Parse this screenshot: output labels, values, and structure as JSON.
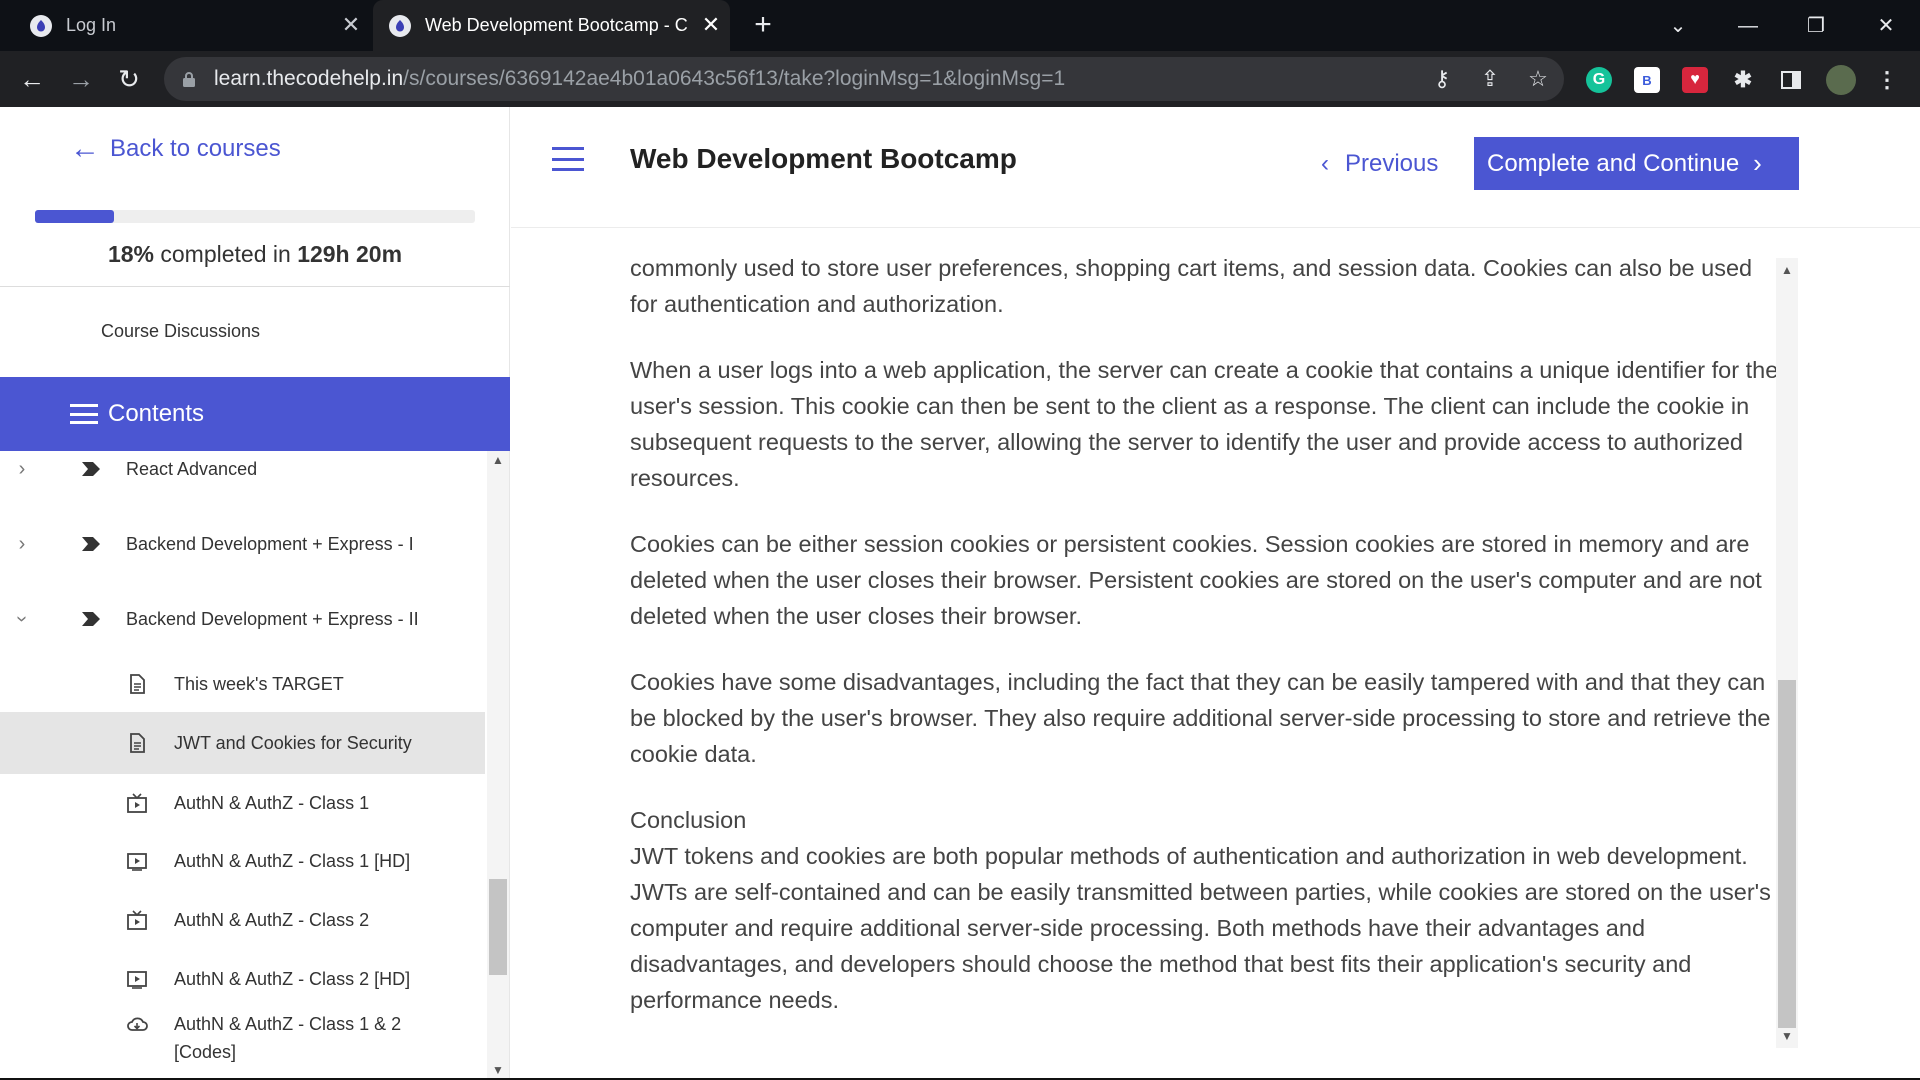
{
  "browser": {
    "tabs": [
      {
        "title": "Log In",
        "active": false
      },
      {
        "title": "Web Development Bootcamp - C",
        "active": true
      }
    ],
    "url_host": "learn.thecodehelp.in",
    "url_path": "/s/courses/6369142ae4b01a0643c56f13/take?loginMsg=1&loginMsg=1",
    "new_tab": "+",
    "close_glyph": "✕"
  },
  "sidebar": {
    "back_label": "Back to courses",
    "progress_fraction": 0.18,
    "progress_percent": "18%",
    "progress_mid": " completed in ",
    "progress_time": "129h 20m",
    "discussions_label": "Course Discussions",
    "contents_label": "Contents",
    "sections": [
      {
        "label": "React Advanced",
        "expanded": false
      },
      {
        "label": "Backend Development + Express - I",
        "expanded": false
      },
      {
        "label": "Backend Development + Express - II",
        "expanded": true
      }
    ],
    "lessons": [
      {
        "label": "This week's TARGET",
        "icon": "document-icon",
        "active": false
      },
      {
        "label": "JWT and Cookies for Security",
        "icon": "document-icon",
        "active": true
      },
      {
        "label": "AuthN & AuthZ - Class 1",
        "icon": "video-live-icon",
        "active": false
      },
      {
        "label": "AuthN & AuthZ - Class 1 [HD]",
        "icon": "video-icon",
        "active": false
      },
      {
        "label": "AuthN & AuthZ - Class 2",
        "icon": "video-live-icon",
        "active": false
      },
      {
        "label": "AuthN & AuthZ - Class 2 [HD]",
        "icon": "video-icon",
        "active": false
      },
      {
        "label": "AuthN & AuthZ - Class 1 & 2",
        "label2": "[Codes]",
        "icon": "cloud-download-icon",
        "active": false
      }
    ]
  },
  "header": {
    "course_title": "Web Development Bootcamp",
    "previous_label": "Previous",
    "complete_label": "Complete and Continue"
  },
  "article": {
    "p1": "commonly used to store user preferences, shopping cart items, and session data. Cookies can also be used for authentication and authorization.",
    "p2": "When a user logs into a web application, the server can create a cookie that contains a unique identifier for the user's session. This cookie can then be sent to the client as a response. The client can include the cookie in subsequent requests to the server, allowing the server to identify the user and provide access to authorized resources.",
    "p3": "Cookies can be either session cookies or persistent cookies. Session cookies are stored in memory and are deleted when the user closes their browser. Persistent cookies are stored on the user's computer and are not deleted when the user closes their browser.",
    "p4": "Cookies have some disadvantages, including the fact that they can be easily tampered with and that they can be blocked by the user's browser. They also require additional server-side processing to store and retrieve the cookie data.",
    "conclusion_heading": "Conclusion",
    "conclusion_text": "JWT tokens and cookies are both popular methods of authentication and authorization in web development. JWTs are self-contained and can be easily transmitted between parties, while cookies are stored on the user's computer and require additional server-side processing. Both methods have their advantages and disadvantages, and developers should choose the method that best fits their application's security and performance needs."
  },
  "colors": {
    "accent": "#4b56d2",
    "active_row": "#e5e5e5",
    "body_text": "#444444"
  }
}
